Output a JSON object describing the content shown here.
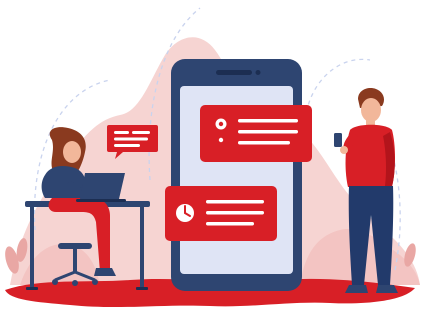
{
  "illustration": {
    "subject": "notification-messages-illustration",
    "colors": {
      "accent_red": "#d81f26",
      "dark_red": "#b3141b",
      "phone_frame": "#2e4571",
      "phone_screen": "#dfe4f5",
      "pink_backdrop": "#f6d4d2",
      "navy_clothes": "#223a6b",
      "skin": "#f2b79a",
      "hair": "#8a3a1f"
    },
    "icons": [
      "chat-bubble-icon",
      "map-pin-icon",
      "clock-icon",
      "smartphone-icon",
      "laptop-icon"
    ]
  }
}
